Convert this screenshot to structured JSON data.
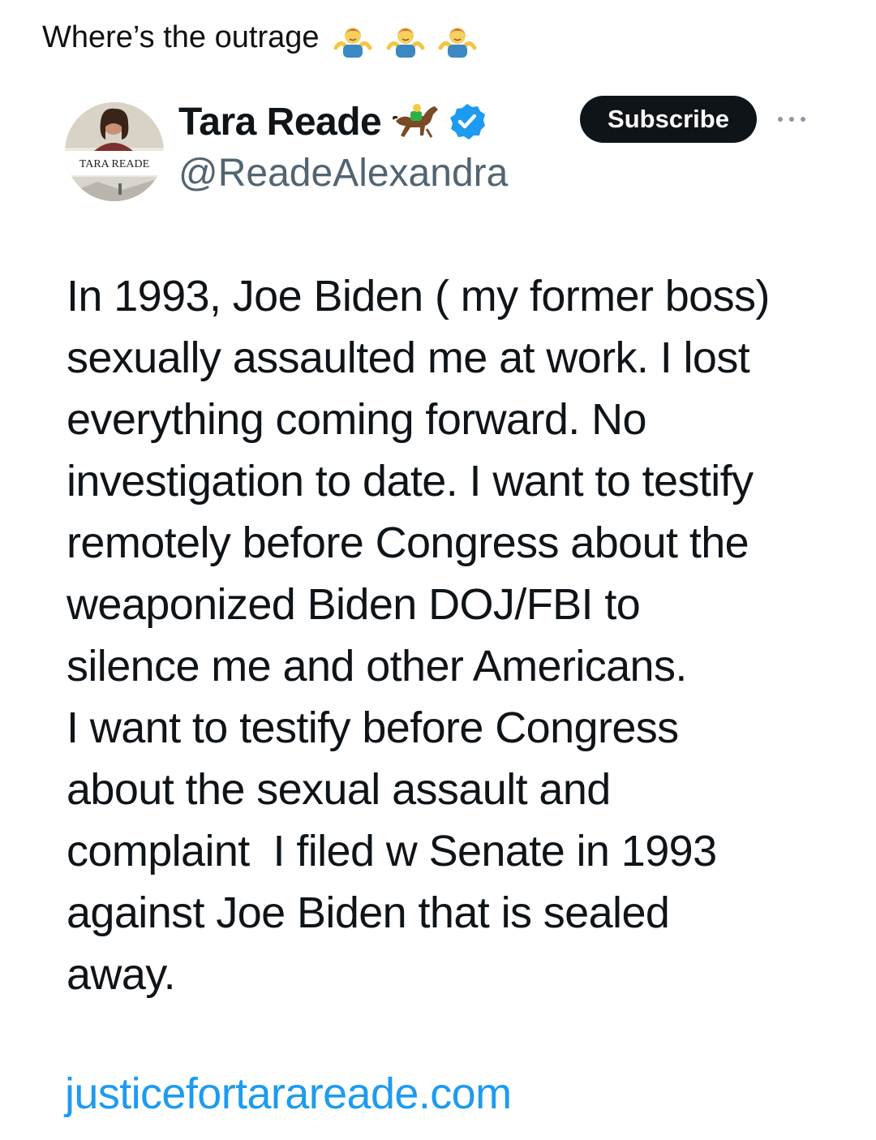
{
  "caption": {
    "text": "Where’s the outrage",
    "emoji": [
      "person-shrugging-icon",
      "person-shrugging-icon",
      "person-shrugging-icon"
    ]
  },
  "tweet": {
    "author": {
      "display_name": "Tara Reade",
      "handle": "@ReadeAlexandra",
      "avatar_text": "TARA READE",
      "name_emoji": "horse-racing-icon",
      "verified_icon": "verified-badge-icon"
    },
    "subscribe_label": "Subscribe",
    "more_icon": "more-options-icon",
    "body_lines": [
      "In 1993, Joe Biden ( my former boss)",
      "sexually assaulted me at work. I lost",
      "everything coming forward. No",
      "investigation to date. I want to testify",
      "remotely before Congress about the",
      "weaponized Biden DOJ/FBI to",
      "silence me and other Americans.",
      "I want to testify before Congress",
      "about the sexual assault and",
      "complaint  I filed w Senate in 1993",
      "against Joe Biden that is sealed",
      "away."
    ],
    "link": "justicefortarareade.com"
  },
  "colors": {
    "text": "#0f1419",
    "secondary": "#536471",
    "link": "#1d9bf0",
    "verified": "#1d9bf0",
    "button_bg": "#0f1419"
  }
}
